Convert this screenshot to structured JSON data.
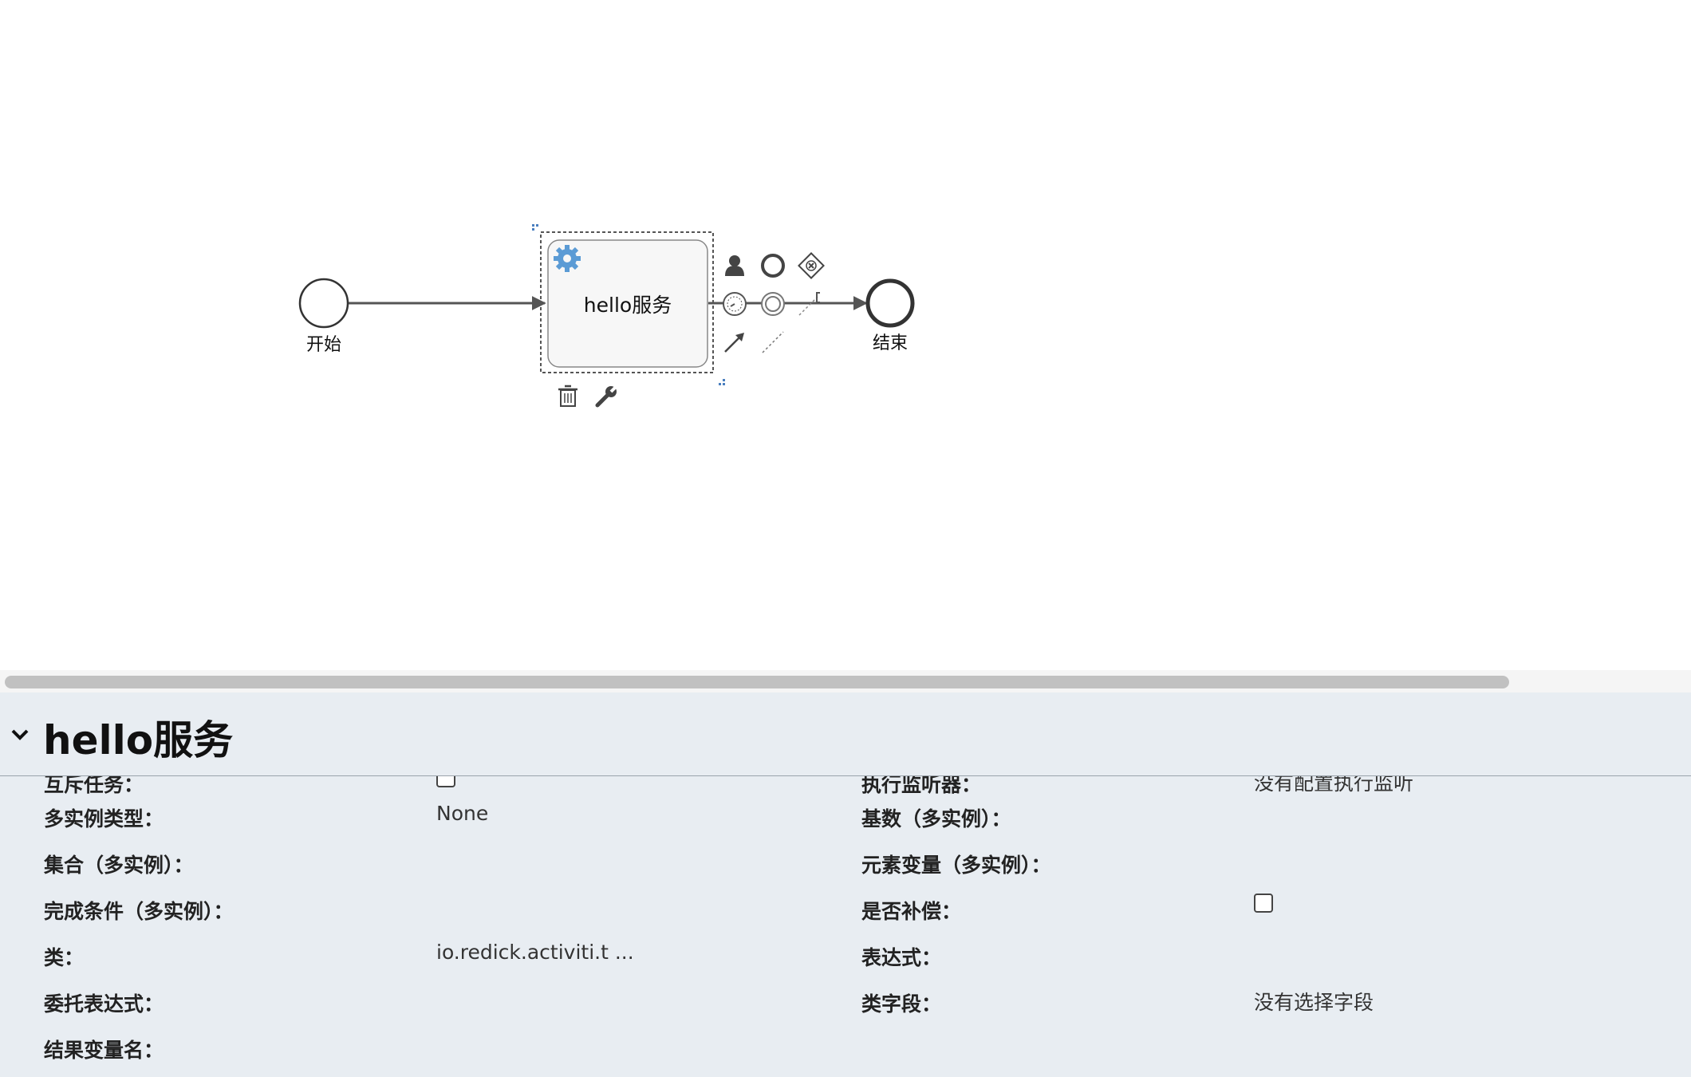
{
  "diagram": {
    "start_label": "开始",
    "task_label": "hello服务",
    "end_label": "结束",
    "context_pad_icons": [
      "user-task-icon",
      "end-event-icon",
      "exclusive-gateway-icon",
      "intermediate-timer-icon",
      "intermediate-event-icon",
      "text-annotation-icon",
      "sequence-flow-icon",
      "association-icon",
      "delete-icon",
      "wrench-icon",
      "gear-icon"
    ]
  },
  "properties": {
    "title": "hello服务",
    "rows": [
      {
        "left_label": "互斥任务：",
        "left_type": "checkbox",
        "left_checked": false,
        "right_label": "执行监听器：",
        "right_value": "没有配置执行监听"
      },
      {
        "left_label": "多实例类型：",
        "left_value": "None",
        "right_label": "基数（多实例）：",
        "right_value": ""
      },
      {
        "left_label": "集合（多实例）：",
        "left_value": "",
        "right_label": "元素变量（多实例）：",
        "right_value": ""
      },
      {
        "left_label": "完成条件（多实例）：",
        "left_value": "",
        "right_label": "是否补偿：",
        "right_type": "checkbox",
        "right_checked": false
      },
      {
        "left_label": "类：",
        "left_value": "io.redick.activiti.t ...",
        "right_label": "表达式：",
        "right_value": ""
      },
      {
        "left_label": "委托表达式：",
        "left_value": "",
        "right_label": "类字段：",
        "right_value": "没有选择字段"
      },
      {
        "left_label": "结果变量名：",
        "left_value": "",
        "right_label": "",
        "right_value": ""
      }
    ]
  },
  "colors": {
    "panel_bg": "#e8edf2",
    "task_icon": "#5b9bd5",
    "flow": "#555555"
  }
}
